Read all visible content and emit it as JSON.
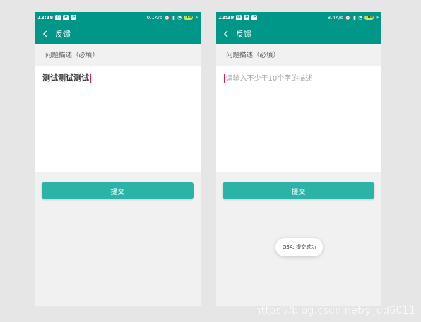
{
  "phones": [
    {
      "status_bar": {
        "time": "12:38",
        "app_icons": [
          "◘",
          "P",
          "P"
        ],
        "network_speed": "0.1K/s",
        "battery": "100"
      },
      "toolbar": {
        "title": "反馈"
      },
      "section_label": "问题描述（必填）",
      "input_value": "测试测试测试",
      "submit_label": "提交"
    },
    {
      "status_bar": {
        "time": "12:39",
        "app_icons": [
          "◘",
          "P",
          "P"
        ],
        "network_speed": "8.4K/s",
        "battery": "100"
      },
      "toolbar": {
        "title": "反馈"
      },
      "section_label": "问题描述（必填）",
      "input_placeholder": "请输入不少于10个字的描述",
      "submit_label": "提交",
      "toast": "GSA: 提交成功"
    }
  ],
  "watermark": "https://blog.csdn.net/y_dd6011",
  "colors": {
    "toolbar": "#009688",
    "button": "#2bb3a7",
    "caret": "#d81b60"
  }
}
